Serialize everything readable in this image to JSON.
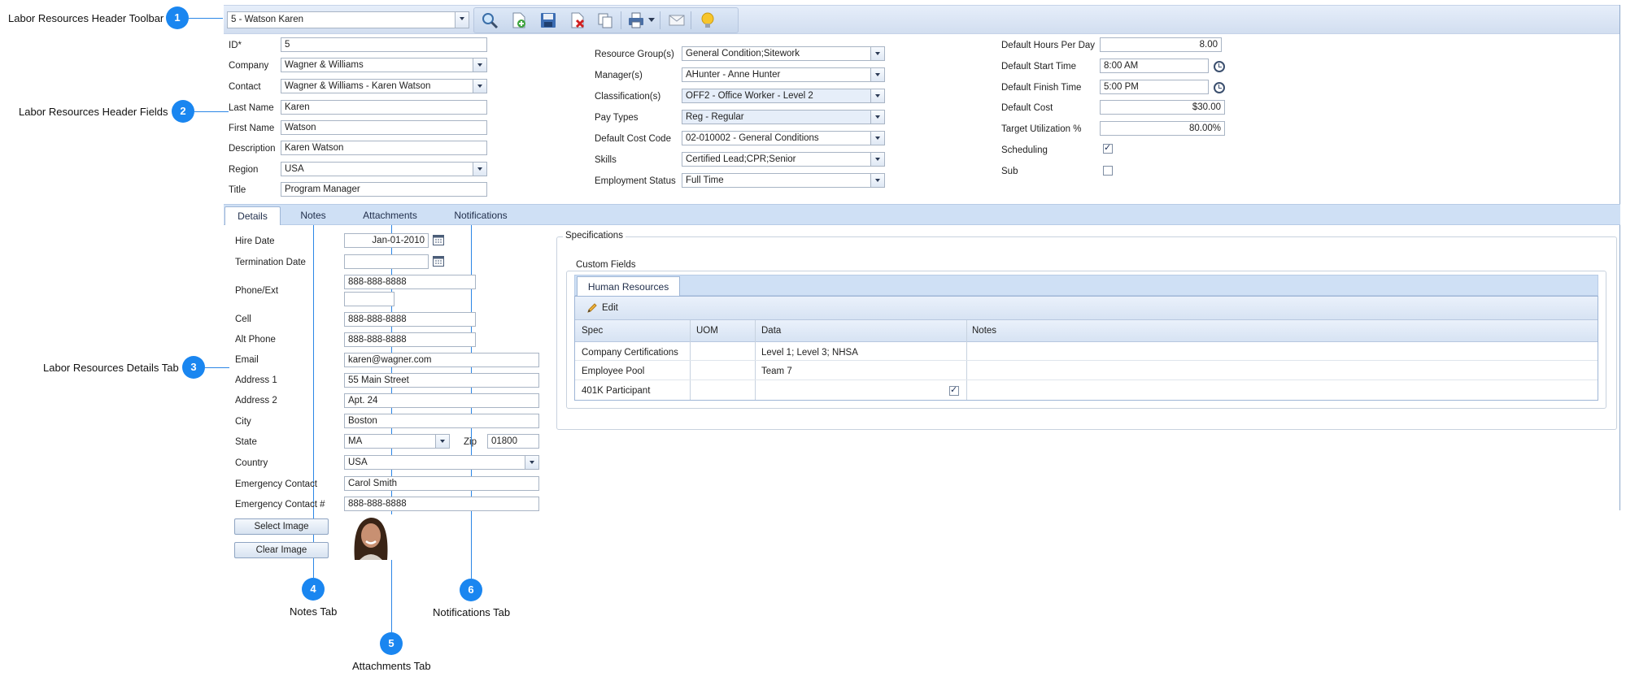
{
  "callouts": [
    {
      "num": "1",
      "label": "Labor Resources Header Toolbar"
    },
    {
      "num": "2",
      "label": "Labor Resources Header Fields"
    },
    {
      "num": "3",
      "label": "Labor Resources Details Tab"
    },
    {
      "num": "4",
      "label": "Notes Tab"
    },
    {
      "num": "5",
      "label": "Attachments Tab"
    },
    {
      "num": "6",
      "label": "Notifications Tab"
    }
  ],
  "toolbar": {
    "record_select": "5 - Watson Karen",
    "icons": [
      "search-icon",
      "add-icon",
      "save-icon",
      "delete-icon",
      "copy-icon",
      "print-icon",
      "email-icon",
      "lightbulb-icon"
    ]
  },
  "header": {
    "id_label": "ID*",
    "id_value": "5",
    "company_label": "Company",
    "company_value": "Wagner & Williams",
    "contact_label": "Contact",
    "contact_value": "Wagner & Williams - Karen Watson",
    "last_name_label": "Last Name",
    "last_name_value": "Karen",
    "first_name_label": "First Name",
    "first_name_value": "Watson",
    "description_label": "Description",
    "description_value": "Karen Watson",
    "region_label": "Region",
    "region_value": "USA",
    "title_label": "Title",
    "title_value": "Program Manager",
    "resource_group_label": "Resource Group(s)",
    "resource_group_value": "General Condition;Sitework",
    "manager_label": "Manager(s)",
    "manager_value": "AHunter - Anne Hunter",
    "classification_label": "Classification(s)",
    "classification_value": "OFF2 - Office Worker - Level 2",
    "pay_types_label": "Pay Types",
    "pay_types_value": "Reg - Regular",
    "cost_code_label": "Default Cost Code",
    "cost_code_value": "02-010002 - General Conditions",
    "skills_label": "Skills",
    "skills_value": "Certified Lead;CPR;Senior",
    "employment_label": "Employment Status",
    "employment_value": "Full Time",
    "hours_label": "Default Hours Per Day",
    "hours_value": "8.00",
    "start_label": "Default Start Time",
    "start_value": "8:00 AM",
    "finish_label": "Default Finish Time",
    "finish_value": "5:00 PM",
    "cost_label": "Default Cost",
    "cost_value": "$30.00",
    "util_label": "Target Utilization %",
    "util_value": "80.00%",
    "scheduling_label": "Scheduling",
    "scheduling_checked": true,
    "sub_label": "Sub",
    "sub_checked": false
  },
  "tabs": [
    "Details",
    "Notes",
    "Attachments",
    "Notifications"
  ],
  "details": {
    "hire_label": "Hire Date",
    "hire_value": "Jan-01-2010",
    "term_label": "Termination Date",
    "term_value": "",
    "phone_label": "Phone/Ext",
    "phone_value": "888-888-8888",
    "ext_value": "",
    "cell_label": "Cell",
    "cell_value": "888-888-8888",
    "alt_label": "Alt Phone",
    "alt_value": "888-888-8888",
    "email_label": "Email",
    "email_value": "karen@wagner.com",
    "addr1_label": "Address 1",
    "addr1_value": "55 Main Street",
    "addr2_label": "Address 2",
    "addr2_value": "Apt. 24",
    "city_label": "City",
    "city_value": "Boston",
    "state_label": "State",
    "state_value": "MA",
    "zip_label": "Zip",
    "zip_value": "01800",
    "country_label": "Country",
    "country_value": "USA",
    "emerg_label": "Emergency Contact",
    "emerg_value": "Carol Smith",
    "emerg_num_label": "Emergency Contact #",
    "emerg_num_value": "888-888-8888",
    "select_image": "Select Image",
    "clear_image": "Clear Image"
  },
  "specs": {
    "legend": "Specifications",
    "custom_legend": "Custom Fields",
    "tab": "Human Resources",
    "edit": "Edit",
    "columns": [
      "Spec",
      "UOM",
      "Data",
      "Notes"
    ],
    "rows": [
      {
        "spec": "Company Certifications",
        "uom": "",
        "data": "Level 1; Level 3; NHSA",
        "notes": ""
      },
      {
        "spec": "Employee Pool",
        "uom": "",
        "data": "Team 7",
        "notes": ""
      },
      {
        "spec": "401K Participant",
        "uom": "",
        "data": "",
        "notes": ""
      }
    ]
  }
}
